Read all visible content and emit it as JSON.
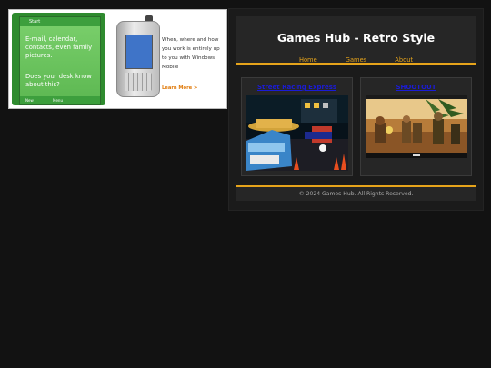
{
  "ad": {
    "screen_header": "Start",
    "screen_text_1": "E-mail, calendar, contacts, even family pictures.",
    "screen_text_2": "Does your desk know about this?",
    "softkey_left": "New",
    "softkey_right": "Menu",
    "tagline": "When, where and how you work is entirely up to you with Windows Mobile",
    "cta": "Learn More >"
  },
  "site": {
    "title": "Games Hub - Retro Style",
    "nav": [
      "Home",
      "Games",
      "About"
    ],
    "footer": "© 2024 Games Hub. All Rights Reserved."
  },
  "games": [
    {
      "title": "Street Racing Express",
      "thumbnail_icon": "street-racing-night-scene"
    },
    {
      "title": "SHOOTOUT",
      "thumbnail_icon": "desert-shootout-scene"
    }
  ],
  "colors": {
    "background": "#121212",
    "panel": "#1b1b1b",
    "accent": "#e6a41b",
    "link": "#1b1bd6"
  }
}
